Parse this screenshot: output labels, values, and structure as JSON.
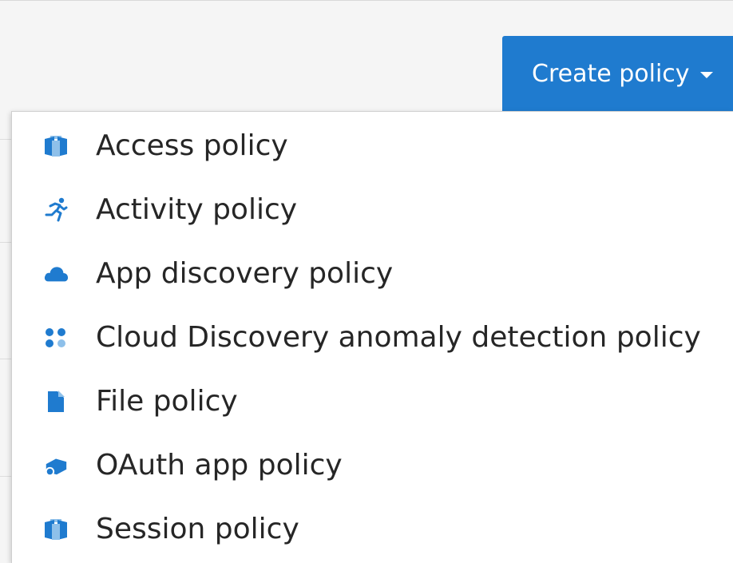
{
  "toolbar": {
    "create_button_label": "Create policy"
  },
  "menu": {
    "items": [
      {
        "label": "Access policy",
        "icon": "access-policy-icon"
      },
      {
        "label": "Activity policy",
        "icon": "running-person-icon"
      },
      {
        "label": "App discovery policy",
        "icon": "cloud-icon"
      },
      {
        "label": "Cloud Discovery anomaly detection policy",
        "icon": "dots-grid-icon"
      },
      {
        "label": "File policy",
        "icon": "file-icon"
      },
      {
        "label": "OAuth app policy",
        "icon": "cube-icon"
      },
      {
        "label": "Session policy",
        "icon": "session-policy-icon"
      }
    ]
  },
  "colors": {
    "accent": "#1f7bcf",
    "icon": "#1f7bcf",
    "icon_light": "#8ec0ea",
    "text": "#262626"
  }
}
